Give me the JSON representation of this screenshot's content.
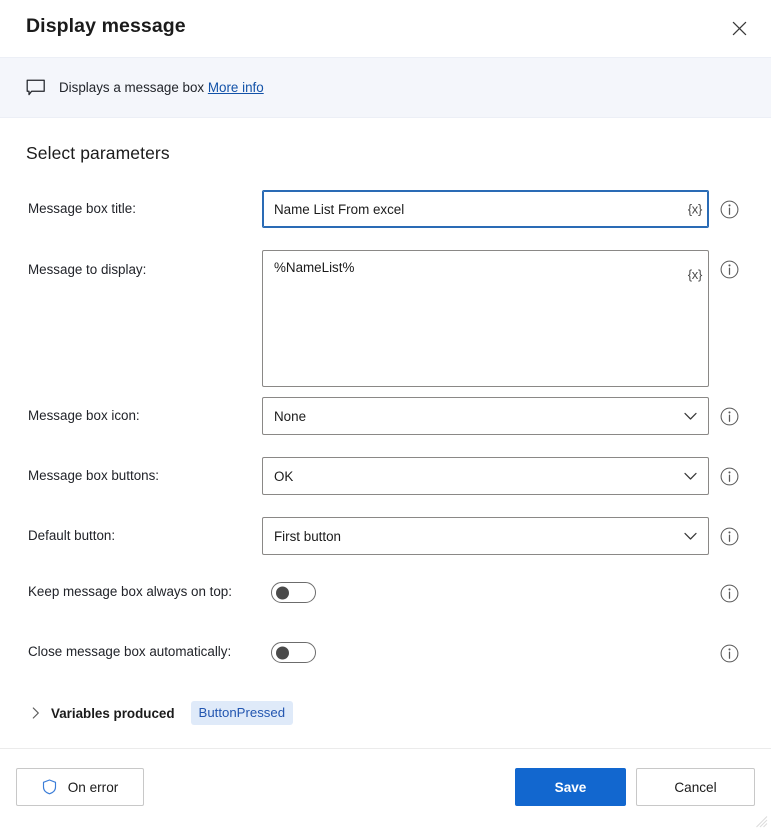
{
  "window": {
    "title": "Display message",
    "close_icon": "close-icon"
  },
  "banner": {
    "icon": "message-box-icon",
    "text": "Displays a message box",
    "link_label": "More info"
  },
  "section": {
    "heading": "Select parameters"
  },
  "fields": [
    {
      "label": "Message box title:",
      "type": "text",
      "value": "Name List From excel",
      "placeholder": "",
      "variable_button": "{x}",
      "focused": true,
      "info_icon": "info-icon"
    },
    {
      "label": "Message to display:",
      "type": "textarea",
      "value": "%NameList%",
      "placeholder": "",
      "variable_button": "{x}",
      "focused": false,
      "info_icon": "info-icon"
    },
    {
      "label": "Message box icon:",
      "type": "select",
      "value": "None",
      "chevron_icon": "chevron-down-icon",
      "info_icon": "info-icon"
    },
    {
      "label": "Message box buttons:",
      "type": "select",
      "value": "OK",
      "chevron_icon": "chevron-down-icon",
      "info_icon": "info-icon"
    },
    {
      "label": "Default button:",
      "type": "select",
      "value": "First button",
      "chevron_icon": "chevron-down-icon",
      "info_icon": "info-icon"
    },
    {
      "label": "Keep message box always on top:",
      "type": "toggle",
      "value": "off",
      "info_icon": "info-icon"
    },
    {
      "label": "Close message box automatically:",
      "type": "toggle",
      "value": "off",
      "info_icon": "info-icon"
    }
  ],
  "variables_produced": {
    "chevron_icon": "chevron-right-icon",
    "label": "Variables produced",
    "badge": "ButtonPressed"
  },
  "footer": {
    "on_error_label": "On error",
    "on_error_icon": "shield-icon",
    "save_label": "Save",
    "cancel_label": "Cancel"
  },
  "colors": {
    "accent": "#1267cf",
    "banner_bg": "#f4f6fb",
    "link": "#1252a8",
    "badge_bg": "#dfeaf9",
    "badge_text": "#2356b0",
    "focus_border": "#2a6bb5"
  }
}
